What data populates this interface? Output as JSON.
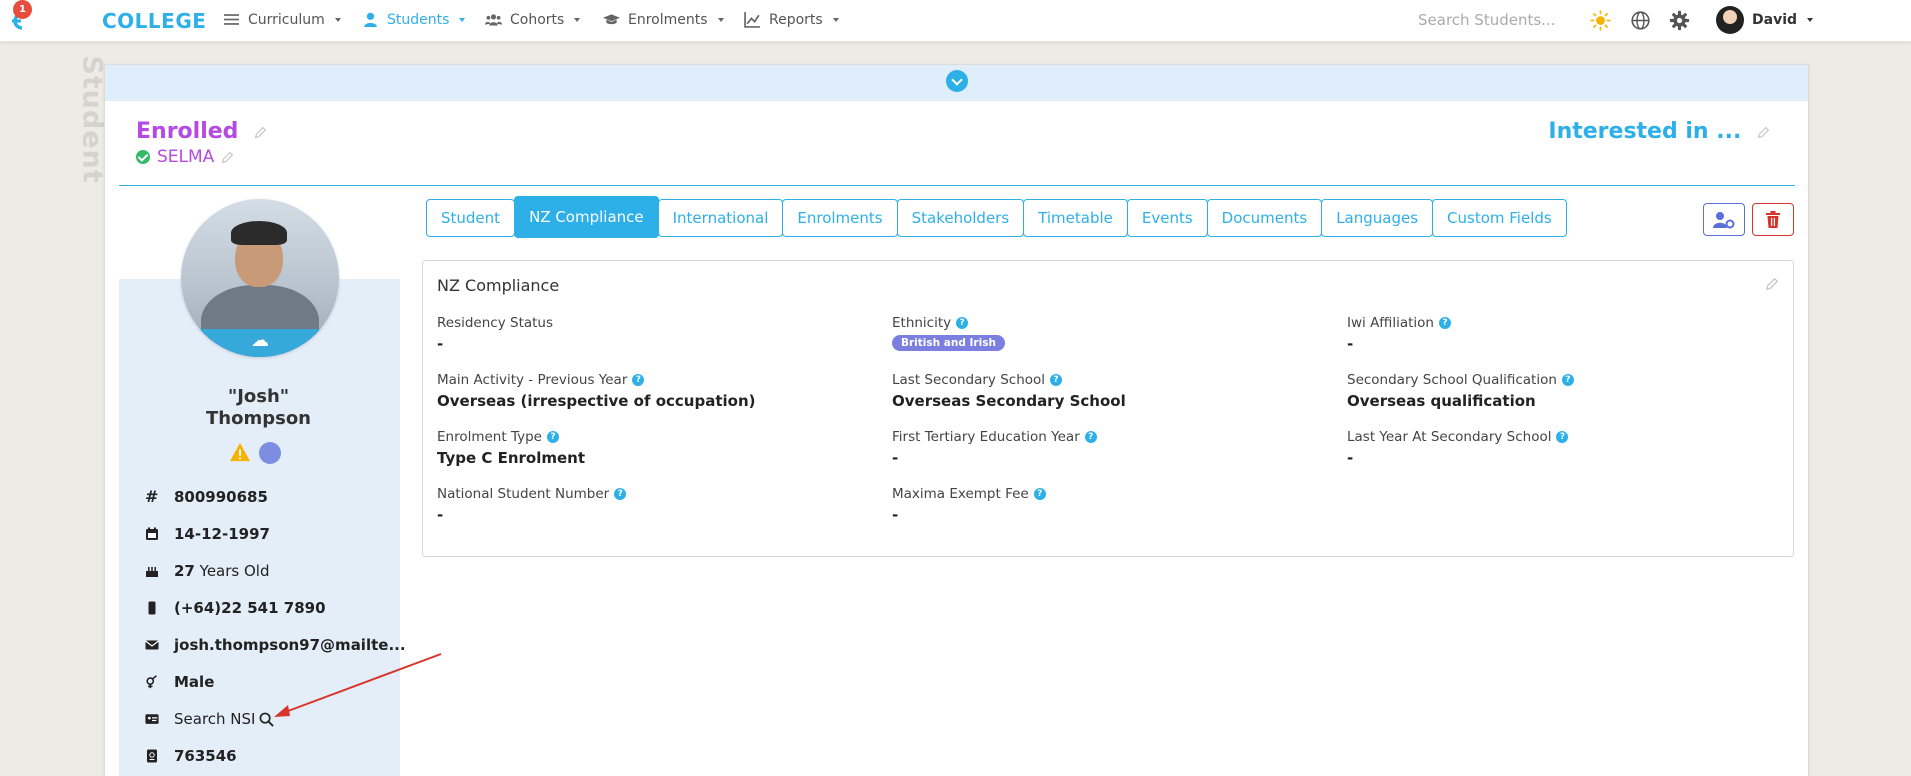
{
  "nav": {
    "notification_count": "1",
    "brand": "COLLEGE",
    "items": [
      {
        "label": "Curriculum",
        "icon": "menu-icon"
      },
      {
        "label": "Students",
        "icon": "user-icon",
        "active": true
      },
      {
        "label": "Cohorts",
        "icon": "users-icon"
      },
      {
        "label": "Enrolments",
        "icon": "graduation-cap-icon"
      },
      {
        "label": "Reports",
        "icon": "chart-line-icon"
      }
    ],
    "search_placeholder": "Search Students...",
    "user_name": "David"
  },
  "page": {
    "side_label": "Student",
    "status": "Enrolled",
    "provider": "SELMA",
    "interested": "Interested in ..."
  },
  "profile": {
    "name_line1": "\"Josh\"",
    "name_line2": "Thompson",
    "student_id": "800990685",
    "dob": "14-12-1997",
    "age_number": "27",
    "age_suffix": "Years Old",
    "phone": "(+64)22 541 7890",
    "email": "josh.thompson97@mailte...",
    "gender": "Male",
    "nsi_label": "Search NSI",
    "other_id": "763546"
  },
  "tabs": [
    {
      "label": "Student"
    },
    {
      "label": "NZ Compliance",
      "active": true
    },
    {
      "label": "International"
    },
    {
      "label": "Enrolments"
    },
    {
      "label": "Stakeholders"
    },
    {
      "label": "Timetable"
    },
    {
      "label": "Events"
    },
    {
      "label": "Documents"
    },
    {
      "label": "Languages"
    },
    {
      "label": "Custom Fields"
    }
  ],
  "compliance": {
    "title": "NZ Compliance",
    "fields": {
      "residency_status": {
        "label": "Residency Status",
        "value": "-"
      },
      "ethnicity": {
        "label": "Ethnicity",
        "value": "British and Irish"
      },
      "iwi_affiliation": {
        "label": "Iwi Affiliation",
        "value": "-"
      },
      "main_activity": {
        "label": "Main Activity - Previous Year",
        "value": "Overseas (irrespective of occupation)"
      },
      "last_secondary_school": {
        "label": "Last Secondary School",
        "value": "Overseas Secondary School"
      },
      "secondary_qualification": {
        "label": "Secondary School Qualification",
        "value": "Overseas qualification"
      },
      "enrolment_type": {
        "label": "Enrolment Type",
        "value": "Type C Enrolment"
      },
      "first_tertiary_year": {
        "label": "First Tertiary Education Year",
        "value": "-"
      },
      "last_year_secondary": {
        "label": "Last Year At Secondary School",
        "value": "-"
      },
      "national_student_number": {
        "label": "National Student Number",
        "value": "-"
      },
      "maxima_exempt_fee": {
        "label": "Maxima Exempt Fee",
        "value": "-"
      }
    }
  },
  "colors": {
    "accent": "#2db0e8",
    "status": "#b44ae2",
    "danger": "#d9342b",
    "ethnicity_pill": "#7b7fe0"
  }
}
